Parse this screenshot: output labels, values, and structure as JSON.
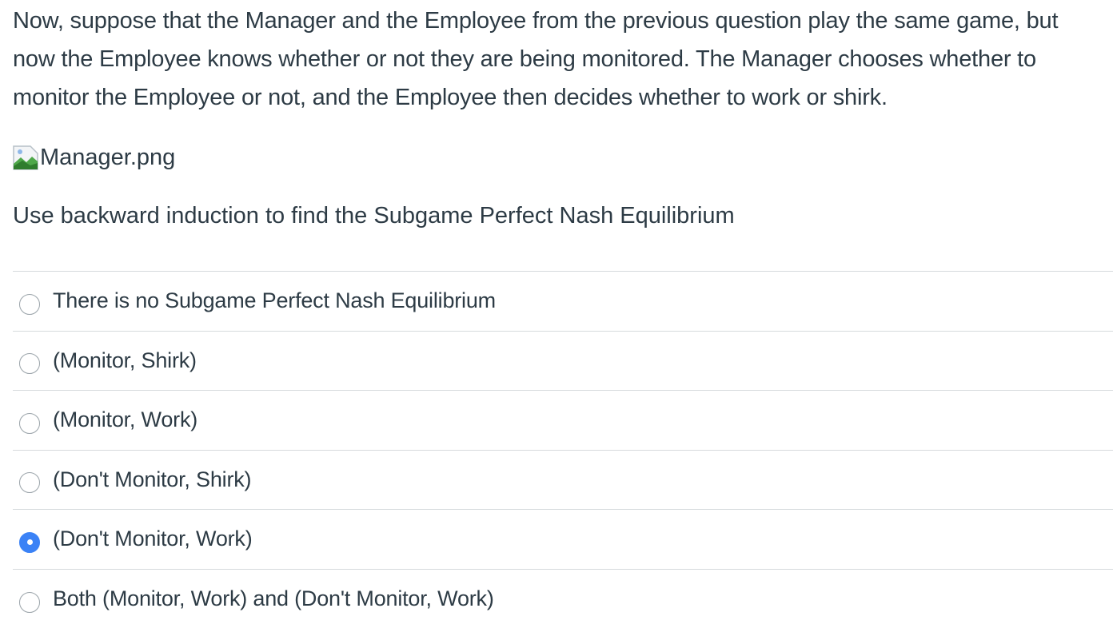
{
  "question": {
    "text": "Now, suppose that the Manager and the Employee from the previous question play the same game, but now the Employee knows whether or not they are being monitored. The Manager chooses whether to monitor the Employee or not, and the Employee then decides whether to work or shirk.",
    "image_alt": "Manager.png",
    "prompt": "Use backward induction to find the Subgame Perfect Nash Equilibrium"
  },
  "answers": [
    {
      "label": "There is no Subgame Perfect Nash Equilibrium",
      "selected": false
    },
    {
      "label": "(Monitor, Shirk)",
      "selected": false
    },
    {
      "label": "(Monitor, Work)",
      "selected": false
    },
    {
      "label": "(Don't Monitor, Shirk)",
      "selected": false
    },
    {
      "label": "(Don't Monitor, Work)",
      "selected": true
    },
    {
      "label": "Both (Monitor, Work) and (Don't Monitor, Work)",
      "selected": false
    }
  ],
  "colors": {
    "text": "#2d3b45",
    "divider": "#d6dadd",
    "radio_selected": "#3b82f6",
    "radio_border": "#9aa3a9"
  },
  "icons": {
    "image": "broken-image-icon",
    "radio": "radio-button-icon"
  }
}
